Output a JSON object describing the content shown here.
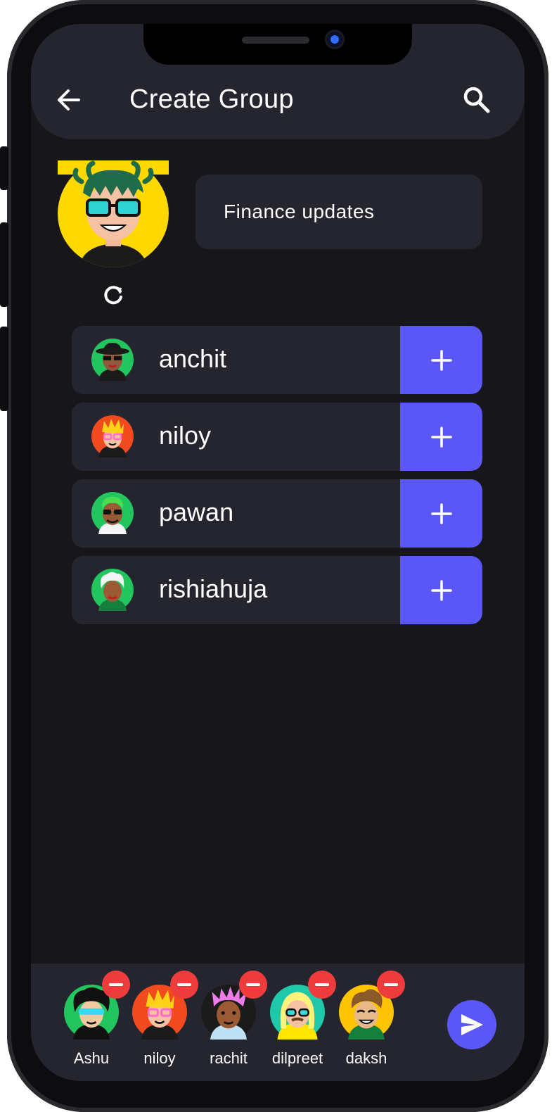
{
  "header": {
    "title": "Create Group"
  },
  "group": {
    "name": "Finance updates"
  },
  "contacts": [
    {
      "name": "anchit"
    },
    {
      "name": "niloy"
    },
    {
      "name": "pawan"
    },
    {
      "name": "rishiahuja"
    }
  ],
  "selected": [
    {
      "name": "Ashu"
    },
    {
      "name": "niloy"
    },
    {
      "name": "rachit"
    },
    {
      "name": "dilpreet"
    },
    {
      "name": "daksh"
    }
  ],
  "colors": {
    "accent": "#5b56f6",
    "remove": "#ee3b3b",
    "surface": "#25252f",
    "background": "#16161b"
  }
}
